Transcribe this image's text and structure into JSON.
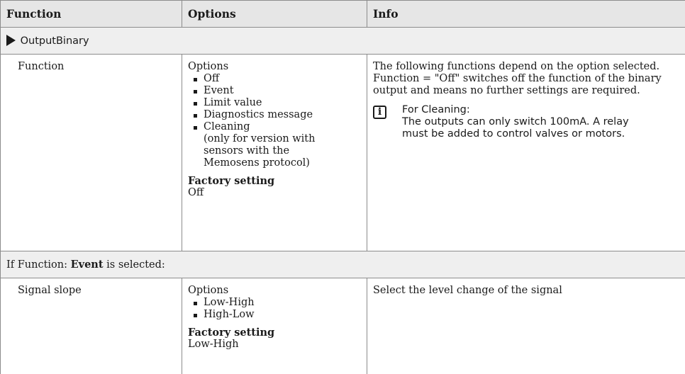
{
  "header": {
    "col1": "Function",
    "col2": "Options",
    "col3": "Info"
  },
  "section1": {
    "title": "OutputBinary"
  },
  "row_function": {
    "name": "Function",
    "options_title": "Options",
    "options": [
      "Off",
      "Event",
      "Limit value",
      "Diagnostics message",
      "Cleaning"
    ],
    "cleaning_note": [
      "(only for version with",
      "sensors with the",
      "Memosens protocol)"
    ],
    "factory_label": "Factory setting",
    "factory_value": "Off",
    "info_lines": [
      "The following functions depend on the option selected.",
      "Function = \"Off\" switches off the function of the binary",
      "output and means no further settings are required."
    ],
    "info_icon": "info-icon",
    "note_title": "For Cleaning:",
    "note_lines": [
      "The outputs can only switch 100mA. A relay",
      "must be added to control valves or motors."
    ]
  },
  "section2": {
    "prefix": "If Function: ",
    "bold": "Event",
    "suffix": " is selected:"
  },
  "row_signal": {
    "name": "Signal slope",
    "options_title": "Options",
    "options": [
      "Low-High",
      "High-Low"
    ],
    "factory_label": "Factory setting",
    "factory_value": "Low-High",
    "info": "Select the level change of the signal"
  }
}
